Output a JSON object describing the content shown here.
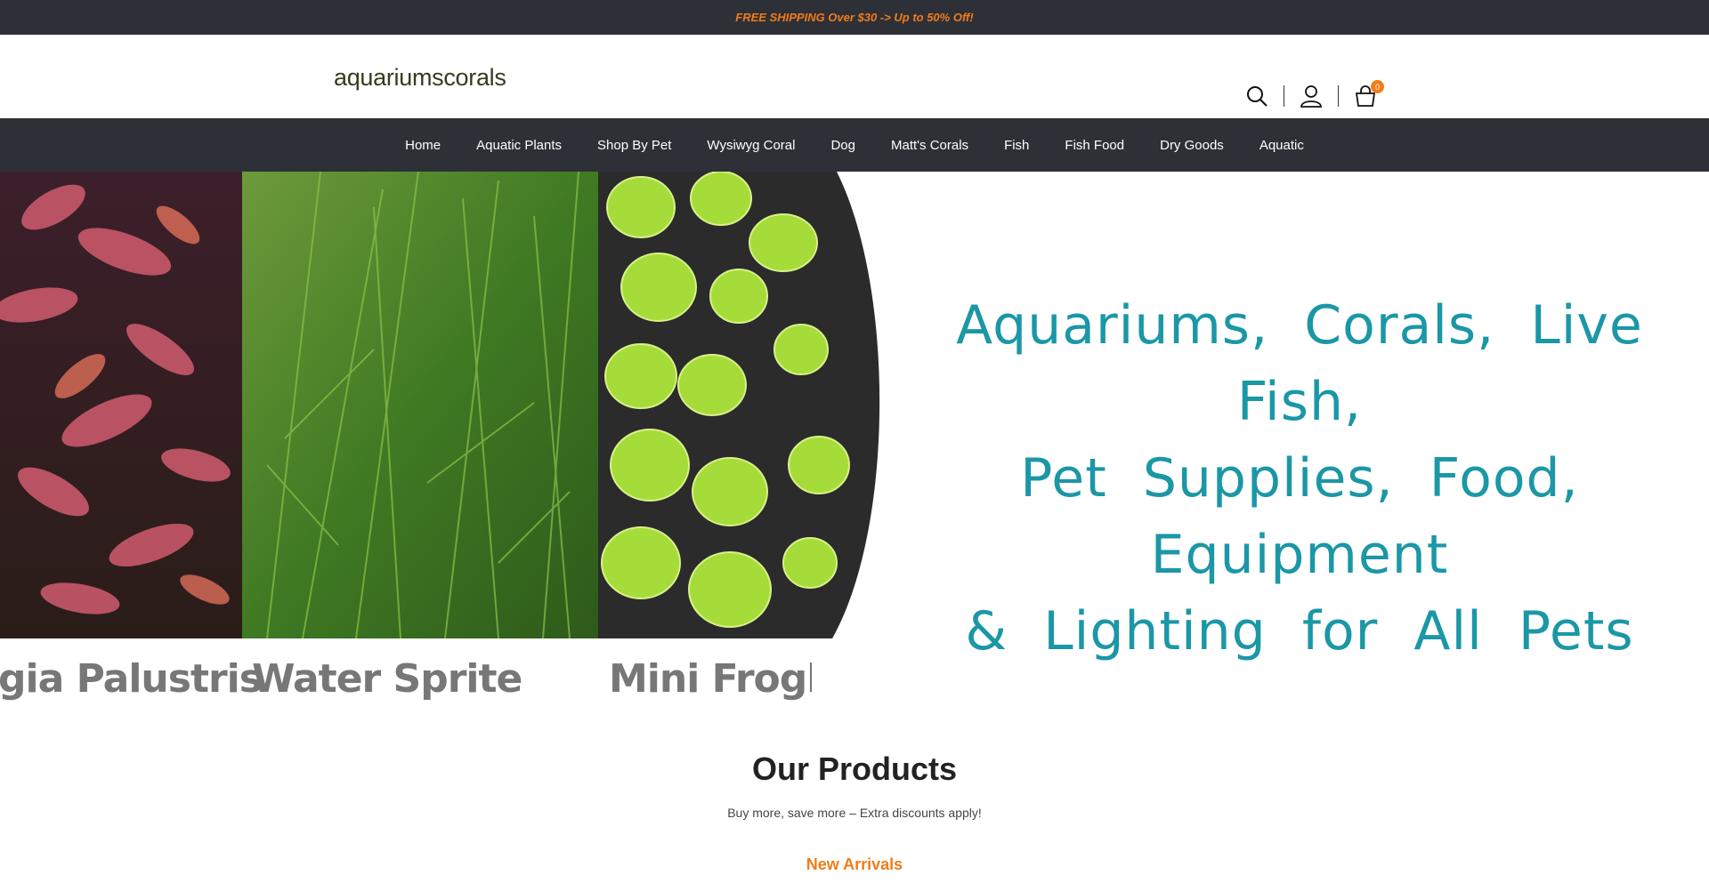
{
  "announcement": "FREE SHIPPING Over $30 -> Up to 50% Off!",
  "logo": "aquariumscorals",
  "header": {
    "icons": [
      "search-icon",
      "user-icon",
      "cart-icon"
    ],
    "cart_count": "0"
  },
  "nav": {
    "items": [
      {
        "label": "Home"
      },
      {
        "label": "Aquatic Plants"
      },
      {
        "label": "Shop By Pet"
      },
      {
        "label": "Wysiwyg Coral"
      },
      {
        "label": "Dog"
      },
      {
        "label": "Matt's Corals"
      },
      {
        "label": "Fish"
      },
      {
        "label": "Fish Food"
      },
      {
        "label": "Dry Goods"
      },
      {
        "label": "Aquatic"
      }
    ]
  },
  "hero": {
    "lines": [
      "Aquariums, Corals, Live Fish,",
      "Pet Supplies, Food, Equipment",
      "& Lighting for All Pets"
    ],
    "plant_labels": [
      "gia Palustris",
      "Water Sprite",
      "Mini Frogb"
    ]
  },
  "products": {
    "title": "Our Products",
    "subtitle": "Buy more, save more – Extra discounts apply!",
    "tab": "New Arrivals"
  },
  "colors": {
    "dark_bar": "#2e3038",
    "accent": "#f07c18",
    "hero_text": "#1b97a6"
  }
}
